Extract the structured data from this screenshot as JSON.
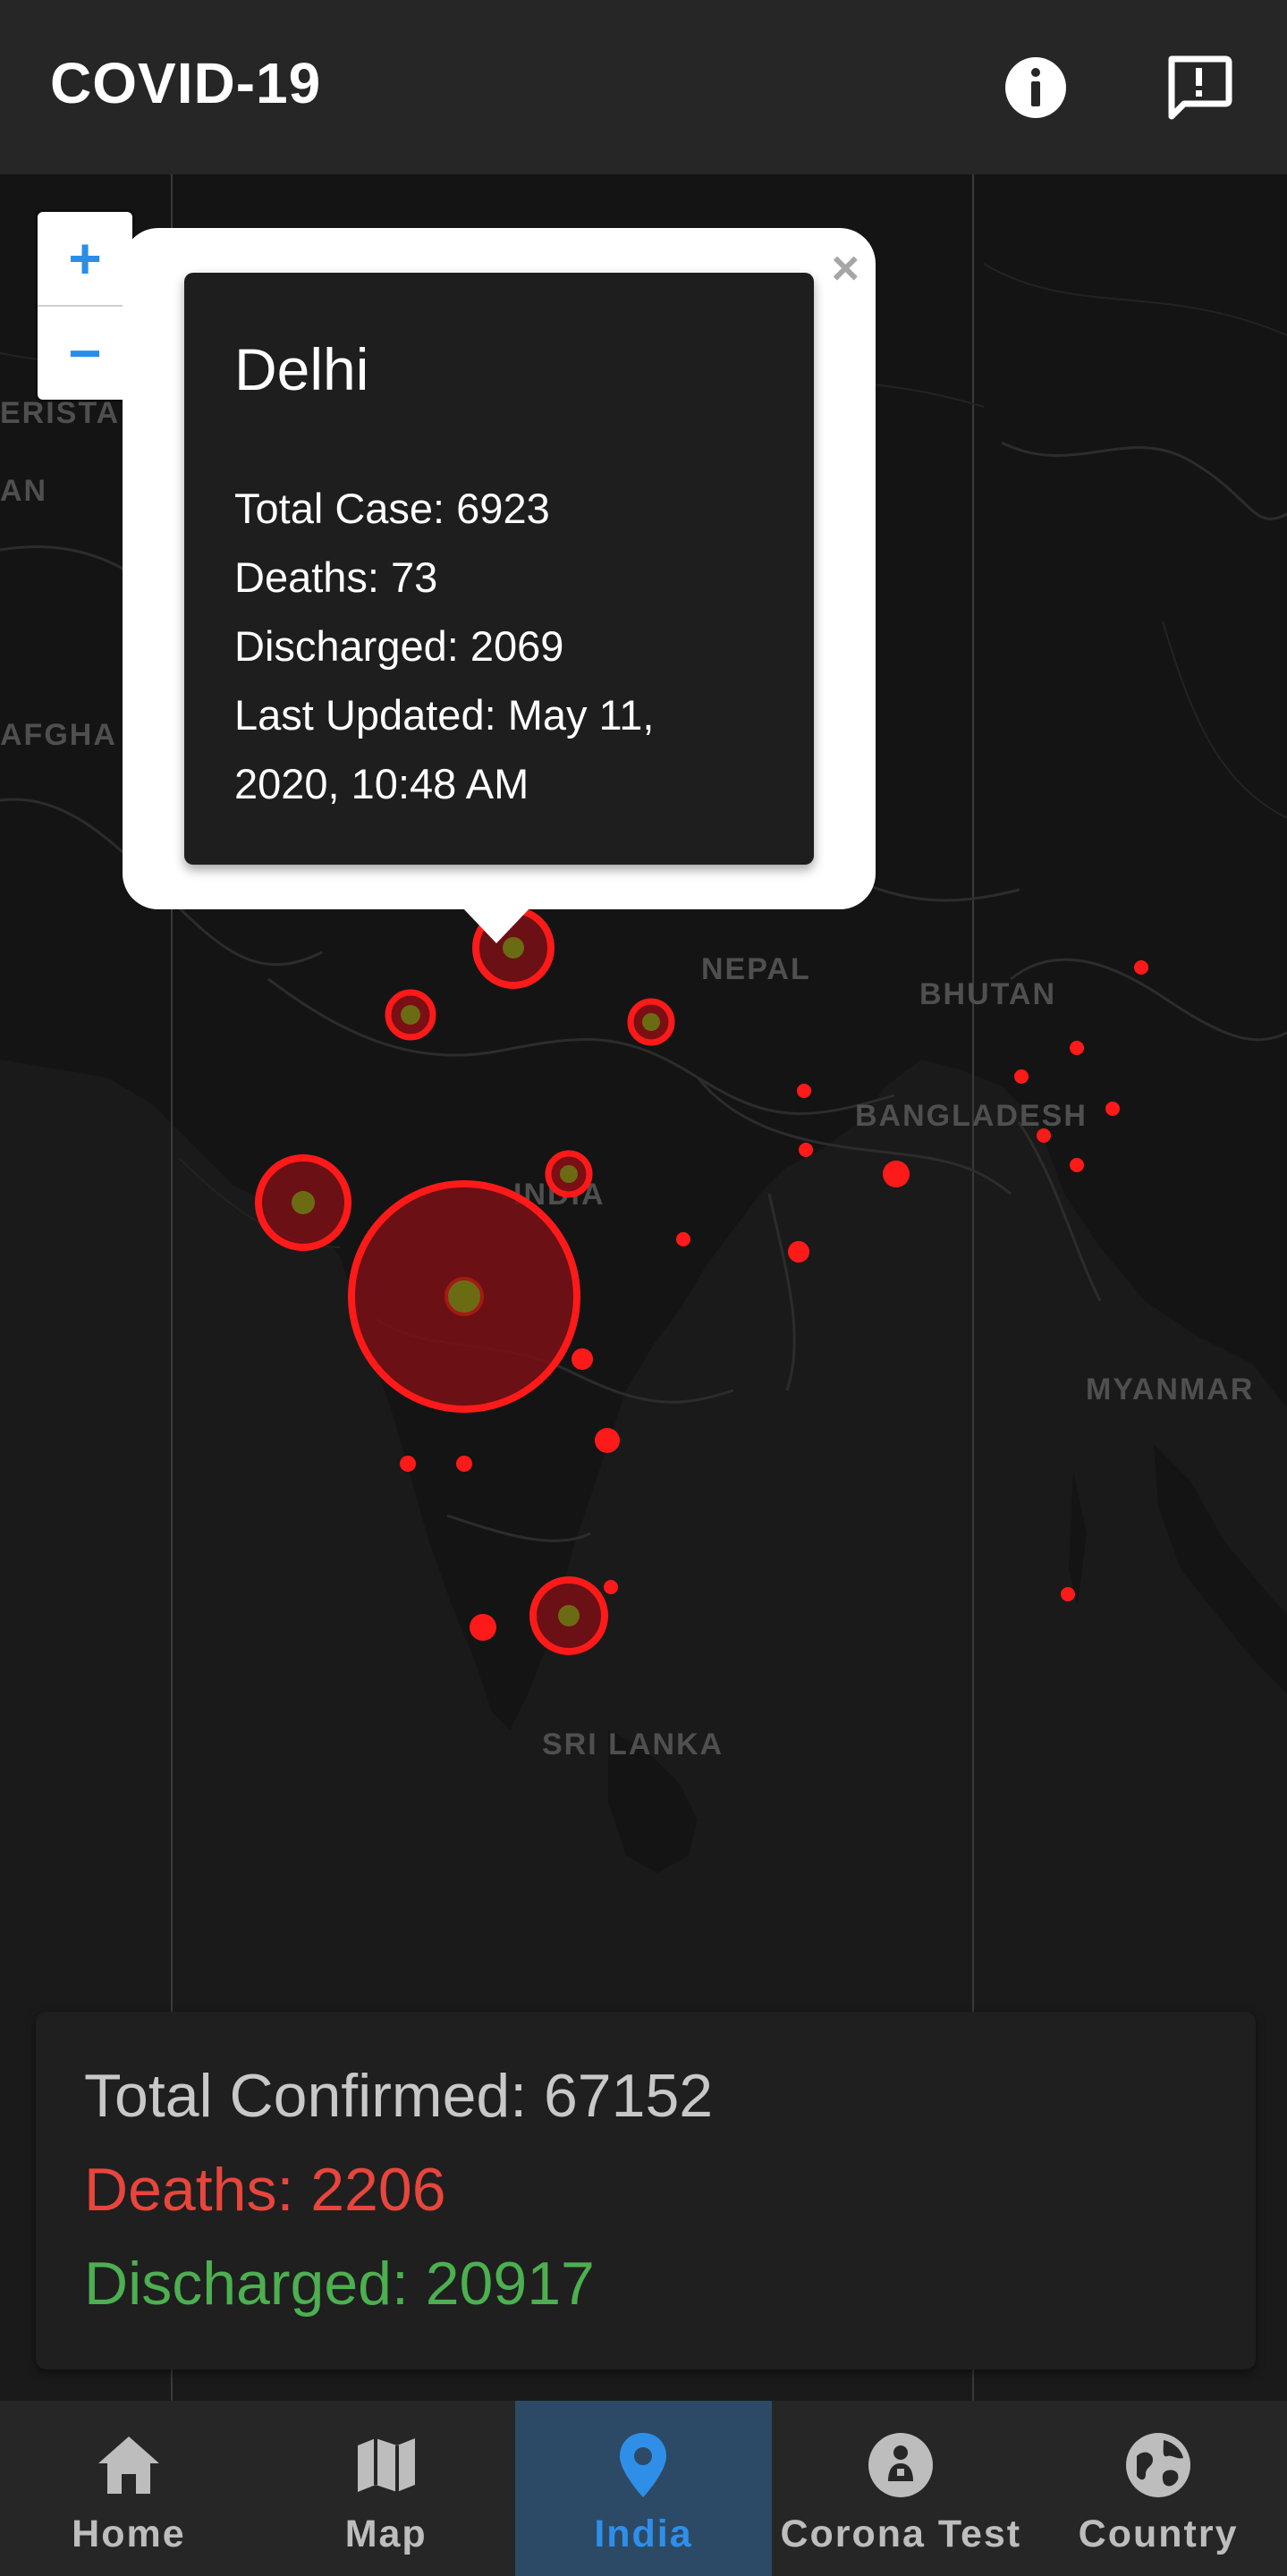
{
  "app": {
    "title": "COVID-19"
  },
  "header_icons": [
    "info-icon",
    "feedback-icon"
  ],
  "zoom": {
    "in_label": "+",
    "out_label": "−"
  },
  "map": {
    "labels": {
      "nepal": "NEPAL",
      "bhutan": "BHUTAN",
      "bangladesh": "BANGLADESH",
      "india": "INDIA",
      "myanmar": "MYANMAR",
      "sri_lanka": "SRI LANKA",
      "afghanistan_partial": "AFGHA",
      "pakistan_partial": "AN",
      "kyrgyz_partial": "ERISTA"
    },
    "marker_color": "#ff1a1a"
  },
  "popup": {
    "close_label": "×",
    "state": "Delhi",
    "total_case": "Total Case: 6923",
    "deaths": "Deaths: 73",
    "discharged": "Discharged: 2069",
    "last_updated_1": "Last Updated: May 11,",
    "last_updated_2": "2020, 10:48 AM"
  },
  "summary": {
    "total": "Total Confirmed: 67152",
    "deaths": "Deaths: 2206",
    "discharged": "Discharged: 20917",
    "colors": {
      "total": "#c8c8c8",
      "deaths": "#e8453c",
      "discharged": "#4caf50"
    }
  },
  "bottom_nav": {
    "items": [
      {
        "label": "Home",
        "icon": "home-icon"
      },
      {
        "label": "Map",
        "icon": "map-icon"
      },
      {
        "label": "India",
        "icon": "location-pin-icon",
        "active": true
      },
      {
        "label": "Corona Test",
        "icon": "person-test-icon"
      },
      {
        "label": "Country",
        "icon": "globe-icon"
      }
    ],
    "active_color": "#2f8fe8"
  }
}
